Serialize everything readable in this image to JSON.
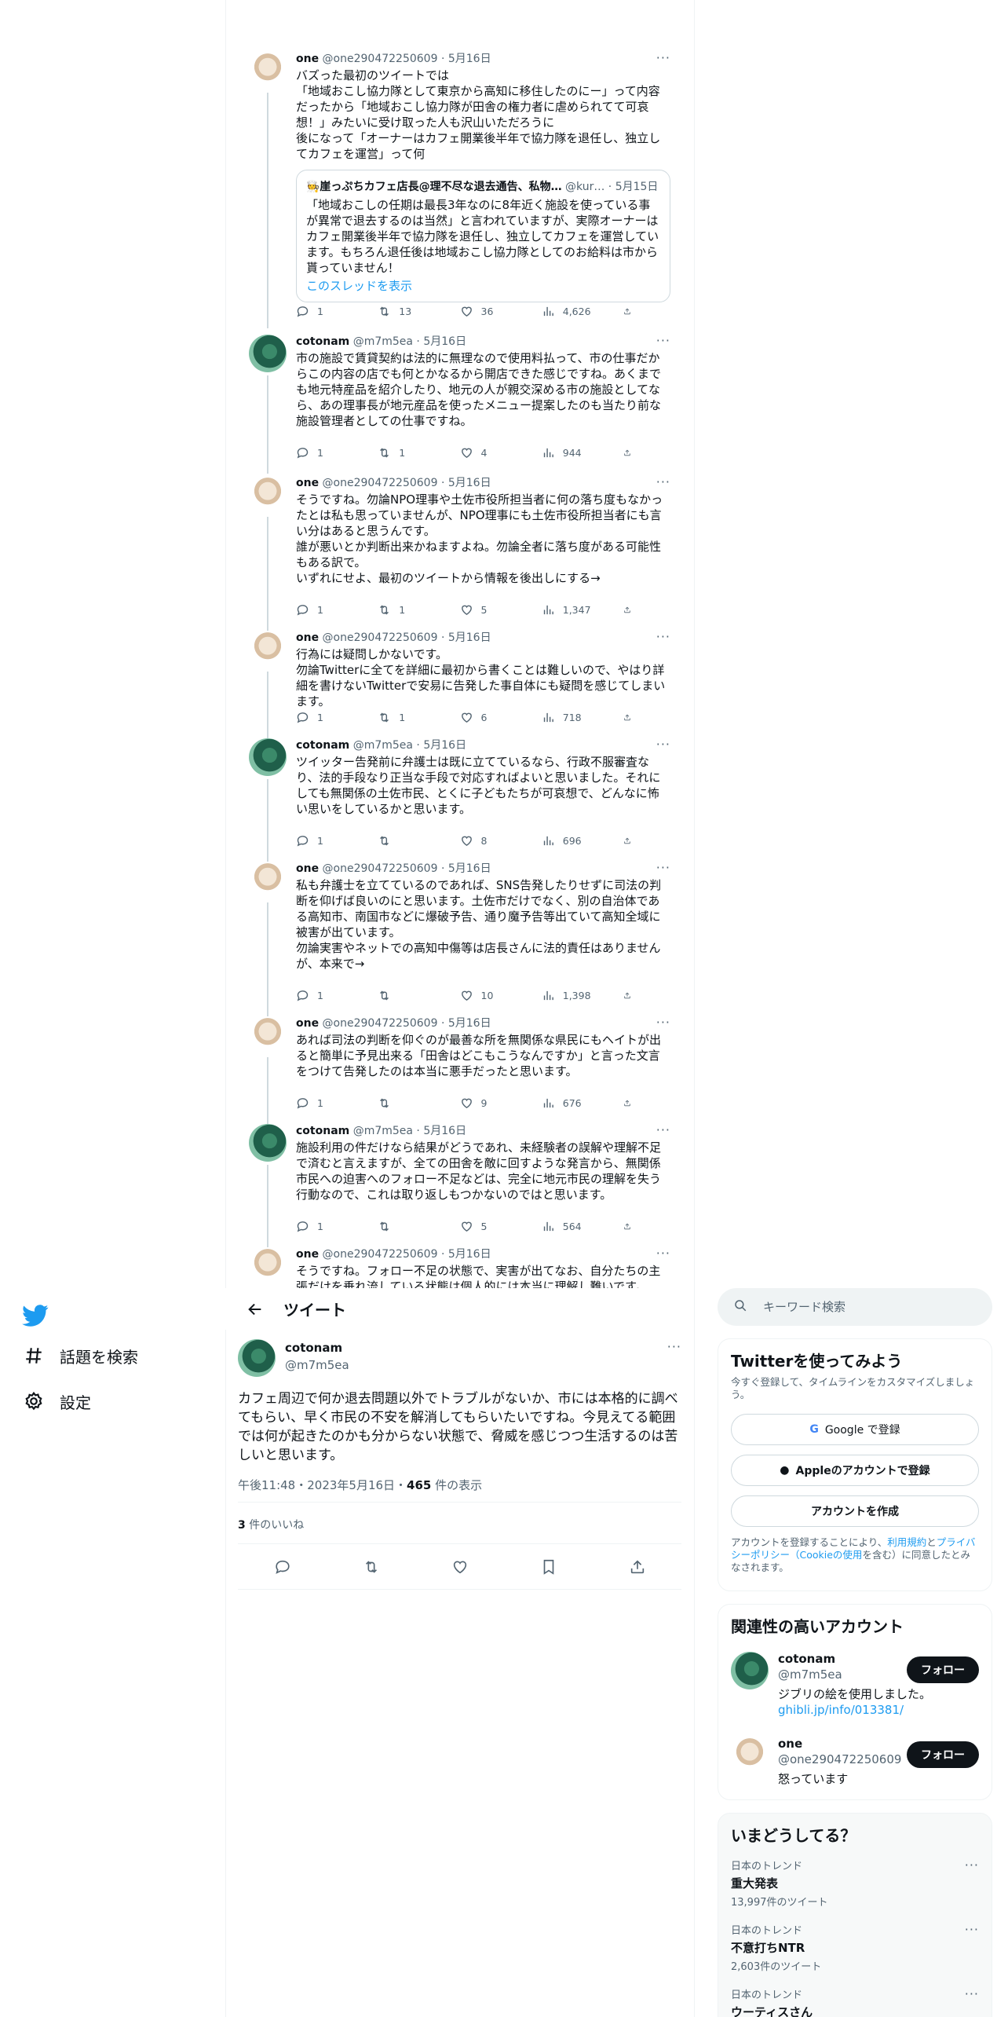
{
  "nav": {
    "explore_label": "話題を検索",
    "settings_label": "設定"
  },
  "thread": [
    {
      "user": "one",
      "handle": "@one290472250609",
      "date": "5月16日",
      "text": "バズった最初のツイートでは\n「地域おこし協力隊として東京から高知に移住したのにー」って内容だったから「地域おこし協力隊が田舎の権力者に虐められてて可哀想！」みたいに受け取った人も沢山いただろうに\n後になって「オーナーはカフェ開業後半年で協力隊を退任し、独立してカフェを運営」って何",
      "quote": {
        "name": "🧑‍🍳崖っぷちカフェ店長@理不尽な退去通告、私物…",
        "handle": "@kur…",
        "date": "5月15日",
        "text": "「地域おこしの任期は最長3年なのに8年近く施設を使っている事が異常で退去するのは当然」と言われていますが、実際オーナーはカフェ開業後半年で協力隊を退任し、独立してカフェを運営しています。もちろん退任後は地域おこし協力隊としてのお給料は市から貰っていません！",
        "link": "このスレッドを表示"
      },
      "replies": "1",
      "retweets": "13",
      "likes": "36",
      "views": "4,626"
    },
    {
      "user": "cotonam",
      "handle": "@m7m5ea",
      "date": "5月16日",
      "text": "市の施設で賃貸契約は法的に無理なので使用料払って、市の仕事だからこの内容の店でも何とかなるから開店できた感じですね。あくまでも地元特産品を紹介したり、地元の人が親交深める市の施設としてなら、あの理事長が地元産品を使ったメニュー提案したのも当たり前な施設管理者としての仕事ですね。",
      "replies": "1",
      "retweets": "1",
      "likes": "4",
      "views": "944"
    },
    {
      "user": "one",
      "handle": "@one290472250609",
      "date": "5月16日",
      "text": "そうですね。勿論NPO理事や土佐市役所担当者に何の落ち度もなかったとは私も思っていませんが、NPO理事にも土佐市役所担当者にも言い分はあると思うんです。\n誰が悪いとか判断出来かねますよね。勿論全者に落ち度がある可能性もある訳で。\nいずれにせよ、最初のツイートから情報を後出しにする→",
      "replies": "1",
      "retweets": "1",
      "likes": "5",
      "views": "1,347"
    },
    {
      "user": "one",
      "handle": "@one290472250609",
      "date": "5月16日",
      "text": "行為には疑問しかないです。\n勿論Twitterに全てを詳細に最初から書くことは難しいので、やはり詳細を書けないTwitterで安易に告発した事自体にも疑問を感じてしまいます。",
      "replies": "1",
      "retweets": "1",
      "likes": "6",
      "views": "718"
    },
    {
      "user": "cotonam",
      "handle": "@m7m5ea",
      "date": "5月16日",
      "text": "ツイッター告発前に弁護士は既に立てているなら、行政不服審査なり、法的手段なり正当な手段で対応すればよいと思いました。それにしても無関係の土佐市民、とくに子どもたちが可哀想で、どんなに怖い思いをしているかと思います。",
      "replies": "1",
      "retweets": "",
      "likes": "8",
      "views": "696"
    },
    {
      "user": "one",
      "handle": "@one290472250609",
      "date": "5月16日",
      "text": "私も弁護士を立てているのであれば、SNS告発したりせずに司法の判断を仰げば良いのにと思います。土佐市だけでなく、別の自治体である高知市、南国市などに爆破予告、通り魔予告等出ていて高知全域に被害が出ています。\n勿論実害やネットでの高知中傷等は店長さんに法的責任はありませんが、本来で→",
      "replies": "1",
      "retweets": "",
      "likes": "10",
      "views": "1,398"
    },
    {
      "user": "one",
      "handle": "@one290472250609",
      "date": "5月16日",
      "text": "あれば司法の判断を仰ぐのが最善な所を無関係な県民にもヘイトが出ると簡単に予見出来る「田舎はどこもこうなんですか」と言った文言をつけて告発したのは本当に悪手だったと思います。",
      "replies": "1",
      "retweets": "",
      "likes": "9",
      "views": "676"
    },
    {
      "user": "cotonam",
      "handle": "@m7m5ea",
      "date": "5月16日",
      "text": "施設利用の件だけなら結果がどうであれ、未経験者の誤解や理解不足で済むと言えますが、全ての田舎を敵に回すような発言から、無関係市民への迫害へのフォロー不足などは、完全に地元市民の理解を失う行動なので、これは取り返しもつかないのではと思います。",
      "replies": "1",
      "retweets": "",
      "likes": "5",
      "views": "564"
    },
    {
      "user": "one",
      "handle": "@one290472250609",
      "date": "5月16日",
      "text": "そうですね。フォロー不足の状態で、実害が出てなお、自分たちの主張だけを垂れ流している状態は個人的には本当に理解し難いです。",
      "replies": "",
      "retweets": "",
      "likes": "",
      "views": ""
    }
  ],
  "header": {
    "title": "ツイート"
  },
  "main_tweet": {
    "user": "cotonam",
    "handle": "@m7m5ea",
    "text": "カフェ周辺で何か退去問題以外でトラブルがないか、市には本格的に調べてもらい、早く市民の不安を解消してもらいたいですね。今見えてる範囲では何が起きたのかも分からない状態で、脅威を感じつつ生活するのは苦しいと思います。",
    "time": "午後11:48・2023年5月16日・",
    "views": "465",
    "views_suffix": " 件の表示",
    "likes": "3",
    "likes_suffix": " 件のいいね"
  },
  "search": {
    "placeholder": "キーワード検索"
  },
  "signup": {
    "title": "Twitterを使ってみよう",
    "subtitle": "今すぐ登録して、タイムラインをカスタマイズしましょう。",
    "google": "Google で登録",
    "apple": "Appleのアカウントで登録",
    "create": "アカウントを作成",
    "legal_pre": "アカウントを登録することにより、",
    "legal_link1": "利用規約",
    "legal_and": "と",
    "legal_link2": "プライバシーポリシー（Cookieの使用",
    "legal_post": "を含む）に同意したとみなされます。"
  },
  "related": {
    "title": "関連性の高いアカウント",
    "follow": "フォロー",
    "accounts": [
      {
        "name": "cotonam",
        "handle": "@m7m5ea",
        "bio": "ジブリの絵を使用しました。",
        "link": "ghibli.jp/info/013381/"
      },
      {
        "name": "one",
        "handle": "@one290472250609",
        "bio": "怒っています",
        "link": ""
      }
    ]
  },
  "trends": {
    "title": "いまどうしてる？",
    "items": [
      {
        "context": "日本のトレンド",
        "name": "重大発表",
        "count": "13,997件のツイート"
      },
      {
        "context": "日本のトレンド",
        "name": "不意打ちNTR",
        "count": "2,603件のツイート"
      },
      {
        "context": "日本のトレンド",
        "name": "ウーティスさん",
        "count": ""
      }
    ]
  },
  "colors": {
    "accent": "#1d9bf0",
    "text": "#0f1419",
    "muted": "#536471",
    "border": "#eff3f4"
  }
}
